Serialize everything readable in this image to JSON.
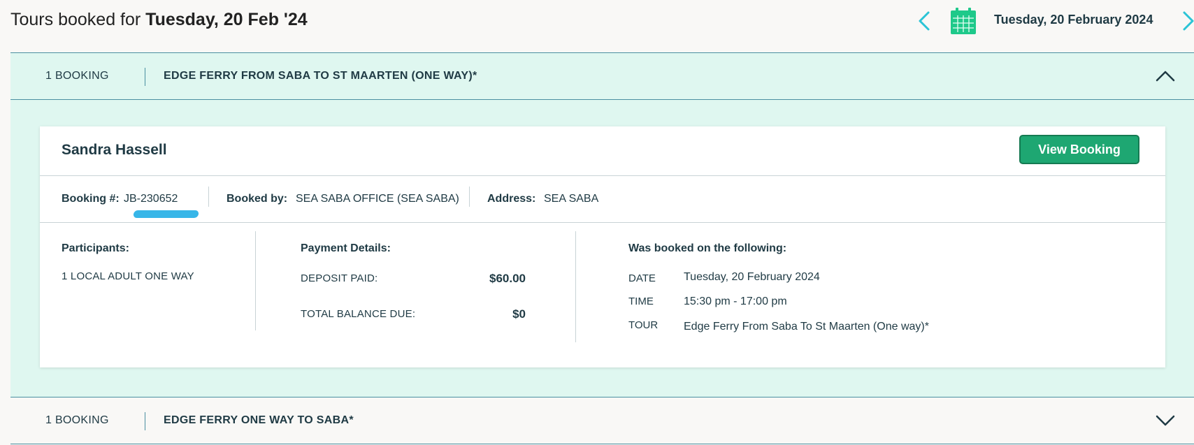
{
  "header": {
    "title_prefix": "Tours booked for ",
    "title_date": "Tuesday, 20 Feb '24",
    "selected_date": "Tuesday, 20 February 2024"
  },
  "tours": [
    {
      "count_label": "1 BOOKING",
      "name": "EDGE FERRY FROM SABA TO ST MAARTEN (ONE WAY)*",
      "expanded": true
    },
    {
      "count_label": "1 BOOKING",
      "name": "EDGE FERRY ONE WAY TO SABA*",
      "expanded": false
    }
  ],
  "booking": {
    "customer_name": "Sandra Hassell",
    "view_button_label": "View Booking",
    "booking_no_label": "Booking #:",
    "booking_no": "JB-230652",
    "booked_by_label": "Booked by:",
    "booked_by": "SEA SABA OFFICE (SEA SABA)",
    "address_label": "Address:",
    "address": "SEA SABA",
    "participants_title": "Participants:",
    "participants": "1 LOCAL ADULT ONE WAY",
    "payment_title": "Payment Details:",
    "deposit_label": "DEPOSIT PAID:",
    "deposit_value": "$60.00",
    "balance_label": "TOTAL BALANCE DUE:",
    "balance_value": "$0",
    "booked_on_title": "Was booked on the following:",
    "date_key": "DATE",
    "date_value": "Tuesday, 20 February 2024",
    "time_key": "TIME",
    "time_value": "15:30 pm - 17:00 pm",
    "tour_key": "TOUR",
    "tour_value": "Edge Ferry From Saba To St Maarten (One way)*"
  },
  "colors": {
    "accent_cyan": "#2bc4d6",
    "calendar_green": "#1ec98a",
    "button_green": "#1ea772",
    "expanded_bg": "#dff7f0",
    "highlight_blue": "#37b6e8"
  },
  "icons": [
    "chevron-left-icon",
    "calendar-icon",
    "chevron-right-icon",
    "chevron-up-icon",
    "chevron-down-icon"
  ]
}
